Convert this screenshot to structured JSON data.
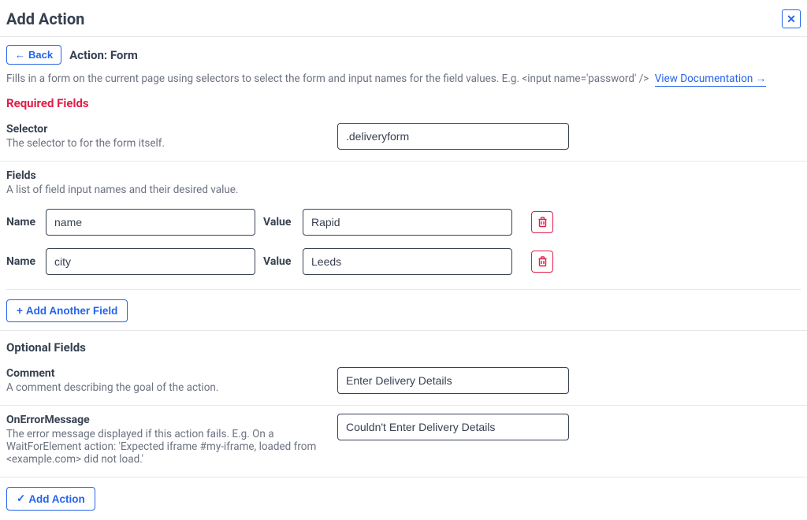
{
  "header": {
    "title": "Add Action"
  },
  "subheader": {
    "back_label": "Back",
    "action_label": "Action: Form"
  },
  "description": "Fills in a form on the current page using selectors to select the form and input names for the field values. E.g. <input name='password' />",
  "doc_link_label": "View Documentation",
  "required_fields_title": "Required Fields",
  "selector": {
    "label": "Selector",
    "desc": "The selector to for the form itself.",
    "value": ".deliveryform"
  },
  "fields_section": {
    "label": "Fields",
    "desc": "A list of field input names and their desired value.",
    "name_label": "Name",
    "value_label": "Value",
    "items": [
      {
        "name": "name",
        "value": "Rapid"
      },
      {
        "name": "city",
        "value": "Leeds"
      }
    ],
    "add_label": "Add Another Field"
  },
  "optional_fields_title": "Optional Fields",
  "comment": {
    "label": "Comment",
    "desc": "A comment describing the goal of the action.",
    "value": "Enter Delivery Details"
  },
  "on_error": {
    "label": "OnErrorMessage",
    "desc": "The error message displayed if this action fails. E.g. On a WaitForElement action: 'Expected iframe #my-iframe, loaded from <example.com> did not load.'",
    "value": "Couldn't Enter Delivery Details"
  },
  "footer": {
    "add_action_label": "Add Action"
  }
}
